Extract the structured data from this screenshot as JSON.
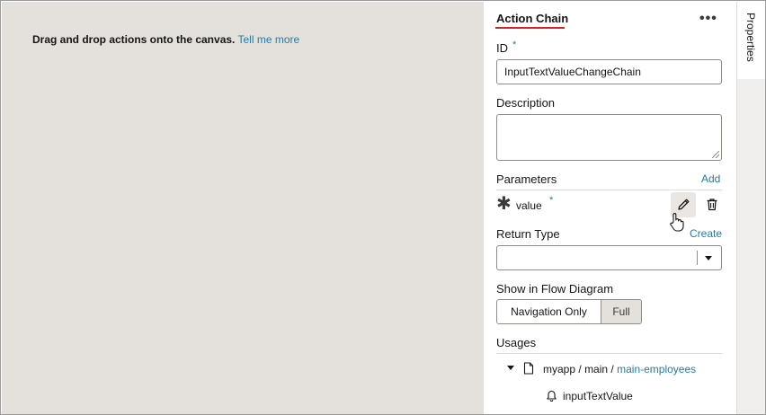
{
  "canvas": {
    "hint_text": "Drag and drop actions onto the canvas.",
    "hint_link": "Tell me more"
  },
  "side_tabs": {
    "properties_label": "Properties"
  },
  "panel": {
    "title": "Action Chain",
    "more_icon": "more-horizontal-icon",
    "id_label": "ID",
    "required_mark": "*",
    "id_value": "InputTextValueChangeChain",
    "description_label": "Description",
    "description_value": "",
    "parameters_label": "Parameters",
    "add_link": "Add",
    "parameters": [
      {
        "name": "value",
        "required_mark": "*",
        "icon": "asterisk-type-icon"
      }
    ],
    "return_type_label": "Return Type",
    "create_link": "Create",
    "return_type_value": "",
    "flow_label": "Show in Flow Diagram",
    "flow_options": [
      "Navigation Only",
      "Full"
    ],
    "flow_selected": "Navigation Only",
    "usages_label": "Usages",
    "usage_path": {
      "segment1": "myapp",
      "sep1": "/",
      "segment2": "main",
      "sep2": "/",
      "link": "main-employees"
    },
    "usage_child": "inputTextValue"
  },
  "colors": {
    "accent_link": "#227ba8",
    "title_underline": "#d5261c",
    "canvas_bg": "#e4e1dc"
  }
}
